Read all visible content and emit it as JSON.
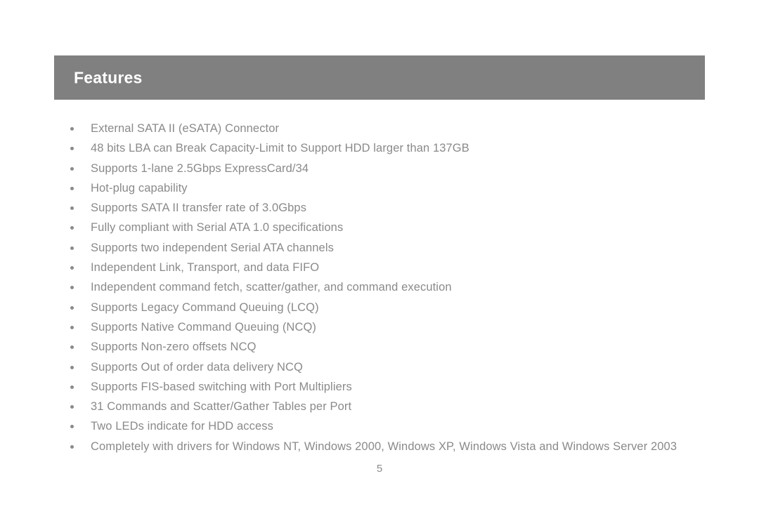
{
  "document": {
    "background_color": "#ffffff",
    "header": {
      "title": "Features",
      "bar_color": "#808080",
      "title_color": "#ffffff"
    },
    "body": {
      "text_color": "#8a8a8a",
      "features": [
        "External SATA II (eSATA) Connector",
        "48 bits LBA can Break Capacity-Limit to Support HDD larger than 137GB",
        "Supports 1-lane 2.5Gbps ExpressCard/34",
        "Hot-plug capability",
        "Supports SATA II transfer rate of 3.0Gbps",
        "Fully compliant with Serial ATA 1.0 specifications",
        "Supports two independent Serial ATA channels",
        "Independent Link, Transport, and data FIFO",
        "Independent command fetch, scatter/gather, and command execution",
        "Supports Legacy Command Queuing (LCQ)",
        "Supports Native Command Queuing (NCQ)",
        "Supports Non-zero offsets NCQ",
        "Supports Out of order data delivery NCQ",
        "Supports FIS-based switching with Port Multipliers",
        "31 Commands and Scatter/Gather Tables per Port",
        "Two LEDs indicate for HDD access",
        "Completely with drivers for Windows NT, Windows 2000, Windows XP, Windows Vista and Windows Server 2003"
      ]
    },
    "footer": {
      "page_number": "5"
    }
  }
}
